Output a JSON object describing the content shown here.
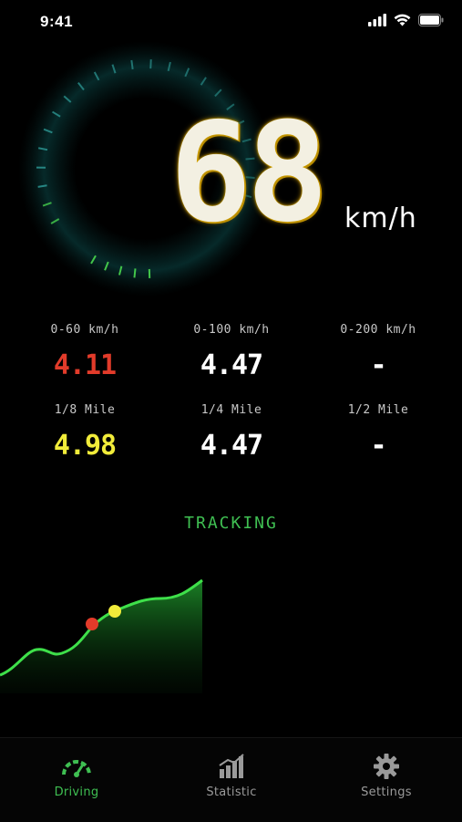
{
  "status_bar": {
    "time": "9:41"
  },
  "speedometer": {
    "speed": "68",
    "unit": "km/h"
  },
  "metrics": [
    {
      "label": "0-60 km/h",
      "value": "4.11",
      "color": "#e23b2a"
    },
    {
      "label": "0-100 km/h",
      "value": "4.47",
      "color": "#ffffff"
    },
    {
      "label": "0-200 km/h",
      "value": "-",
      "color": "#ffffff"
    },
    {
      "label": "1/8 Mile",
      "value": "4.98",
      "color": "#f1ec3a"
    },
    {
      "label": "1/4 Mile",
      "value": "4.47",
      "color": "#ffffff"
    },
    {
      "label": "1/2 Mile",
      "value": "-",
      "color": "#ffffff"
    }
  ],
  "tracking": {
    "title": "TRACKING"
  },
  "tabs": [
    {
      "label": "Driving",
      "icon": "speedometer-icon",
      "active": true
    },
    {
      "label": "Statistic",
      "icon": "bar-chart-icon",
      "active": false
    },
    {
      "label": "Settings",
      "icon": "gear-icon",
      "active": false
    }
  ],
  "colors": {
    "accent": "#3fbf52",
    "background": "#000000",
    "marker_red": "#e23b2a",
    "marker_yellow": "#f1ec3a"
  }
}
